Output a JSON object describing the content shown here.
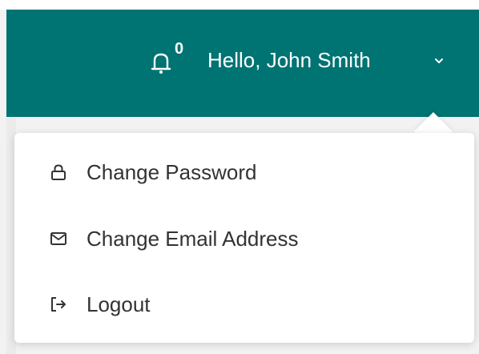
{
  "header": {
    "notification_count": "0",
    "greeting": "Hello, John Smith",
    "background_color": "#007373"
  },
  "menu": {
    "items": [
      {
        "icon": "lock-icon",
        "label": "Change Password"
      },
      {
        "icon": "envelope-icon",
        "label": "Change Email Address"
      },
      {
        "icon": "logout-icon",
        "label": "Logout"
      }
    ]
  }
}
